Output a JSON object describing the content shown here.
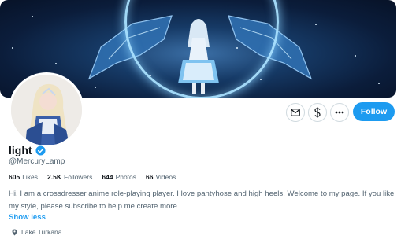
{
  "profile": {
    "name": "light",
    "handle": "@MercuryLamp",
    "bio": "Hi, I am a crossdresser anime role-playing player. I love pantyhose and high heels. Welcome to my page. If you like my style, please subscribe to help me create more.",
    "show_less_label": "Show less",
    "location": "Lake Turkana",
    "stats": [
      {
        "value": "605",
        "label": "Likes"
      },
      {
        "value": "2.5K",
        "label": "Followers"
      },
      {
        "value": "644",
        "label": "Photos"
      },
      {
        "value": "66",
        "label": "Videos"
      }
    ]
  },
  "actions": {
    "follow_label": "Follow",
    "message_icon": "envelope-icon",
    "tip_icon": "dollar-icon",
    "more_icon": "more-icon"
  },
  "colors": {
    "accent": "#1d9bf0",
    "text_primary": "#0f1419",
    "text_secondary": "#536471"
  }
}
